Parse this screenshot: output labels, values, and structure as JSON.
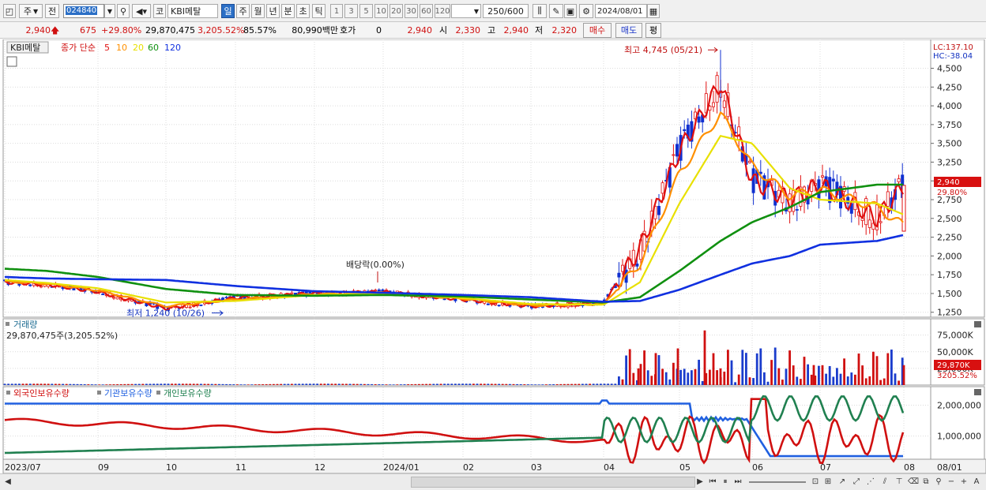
{
  "toolbar": {
    "period_select": "주",
    "prev_label": "전",
    "code_value": "024840",
    "market_label": "코",
    "stock_name": "KBI메탈",
    "periods": [
      "일",
      "주",
      "월",
      "년",
      "분",
      "초",
      "틱"
    ],
    "active_period": "일",
    "intervals": [
      "1",
      "3",
      "5",
      "10",
      "20",
      "30",
      "60",
      "120"
    ],
    "count_value": "250",
    "count_total": "/600",
    "date_value": "2024/08/01"
  },
  "info": {
    "price": "2,940",
    "change": "675",
    "change_pct": "+29.80%",
    "volume": "29,870,475",
    "volume_pct": "3,205.52%",
    "turnover_pct": "85.57%",
    "amount": "80,990백만",
    "hoga_label": "호가",
    "hoga_value": "0",
    "hoga_price": "2,940",
    "open_label": "시",
    "open": "2,330",
    "high_label": "고",
    "high": "2,940",
    "low_label": "저",
    "low": "2,320",
    "buy_button": "매수",
    "sell_button": "매도",
    "eval_button": "평"
  },
  "price_panel": {
    "stock_tag": "KBI메탈",
    "legend_title": "종가 단순",
    "ma_periods": [
      "5",
      "10",
      "20",
      "60",
      "120"
    ],
    "ma_colors": [
      "#e01010",
      "#ff9000",
      "#e8e000",
      "#109010",
      "#1030e0"
    ],
    "lc": "LC:137.10",
    "hc": "HC:-38.04",
    "high_note": "최고 4,745 (05/21)",
    "low_note": "최저 1,240 (10/26)",
    "dividend_note": "배당락(0.00%)",
    "last_price_tag": "2,940",
    "last_pct_tag": "29.80%",
    "y_ticks": [
      "4,500",
      "4,250",
      "4,000",
      "3,750",
      "3,500",
      "3,250",
      "3,000",
      "2,750",
      "2,500",
      "2,250",
      "2,000",
      "1,750",
      "1,500",
      "1,250"
    ]
  },
  "volume_panel": {
    "title": "거래량",
    "current": "29,870,475주(3,205.52%)",
    "y_ticks": [
      "75,000K",
      "50,000K",
      "25,000K"
    ],
    "last_tag": "29,870K",
    "last_pct": "3205.52%"
  },
  "holding_panel": {
    "series": [
      "외국인보유수량",
      "기관보유수량",
      "개인보유수량"
    ],
    "series_colors": [
      "#d01010",
      "#2060e0",
      "#208050"
    ],
    "y_ticks": [
      "2,000,000",
      "1,000,000"
    ]
  },
  "x_axis": {
    "labels": [
      "2023/07",
      "09",
      "10",
      "11",
      "12",
      "2024/01",
      "02",
      "03",
      "04",
      "05",
      "06",
      "07",
      "08",
      "08/01"
    ]
  },
  "chart_data": [
    {
      "type": "line",
      "title": "KBI메탈",
      "x": [
        "2023/07",
        "2023/08",
        "2023/09",
        "2023/10",
        "2023/11",
        "2023/12",
        "2024/01",
        "2024/02",
        "2024/03",
        "2024/04",
        "2024/04 mid",
        "2024/05",
        "2024/05/21",
        "2024/06",
        "2024/06 mid",
        "2024/07",
        "2024/07 mid",
        "2024/08/01"
      ],
      "series": [
        {
          "name": "5",
          "values": [
            1650,
            1620,
            1520,
            1300,
            1440,
            1500,
            1520,
            1420,
            1330,
            1370,
            2100,
            3400,
            4300,
            3000,
            2750,
            2950,
            2500,
            2940
          ]
        },
        {
          "name": "10",
          "values": [
            1660,
            1630,
            1540,
            1330,
            1420,
            1490,
            1510,
            1430,
            1340,
            1360,
            1900,
            3100,
            3900,
            3200,
            2800,
            2880,
            2650,
            2400
          ]
        },
        {
          "name": "20",
          "values": [
            1680,
            1640,
            1570,
            1380,
            1400,
            1480,
            1500,
            1440,
            1360,
            1350,
            1650,
            2700,
            3600,
            3500,
            2900,
            2750,
            2700,
            2550
          ]
        },
        {
          "name": "60",
          "values": [
            1830,
            1800,
            1720,
            1560,
            1480,
            1470,
            1480,
            1460,
            1420,
            1380,
            1450,
            1800,
            2200,
            2450,
            2650,
            2850,
            2950,
            2950
          ]
        },
        {
          "name": "120",
          "values": [
            1720,
            1700,
            1690,
            1680,
            1600,
            1530,
            1510,
            1480,
            1450,
            1390,
            1400,
            1550,
            1750,
            1900,
            2000,
            2150,
            2200,
            2280
          ]
        }
      ],
      "ylim": [
        1100,
        4800
      ]
    },
    {
      "type": "bar",
      "title": "거래량",
      "categories": [
        "2024/04",
        "2024/04 mid",
        "2024/05",
        "2024/05/21",
        "2024/06",
        "2024/07",
        "2024/08/01"
      ],
      "values": [
        25000,
        48000,
        55000,
        82000,
        25000,
        30000,
        29870
      ],
      "ylim": [
        0,
        90000
      ]
    }
  ]
}
